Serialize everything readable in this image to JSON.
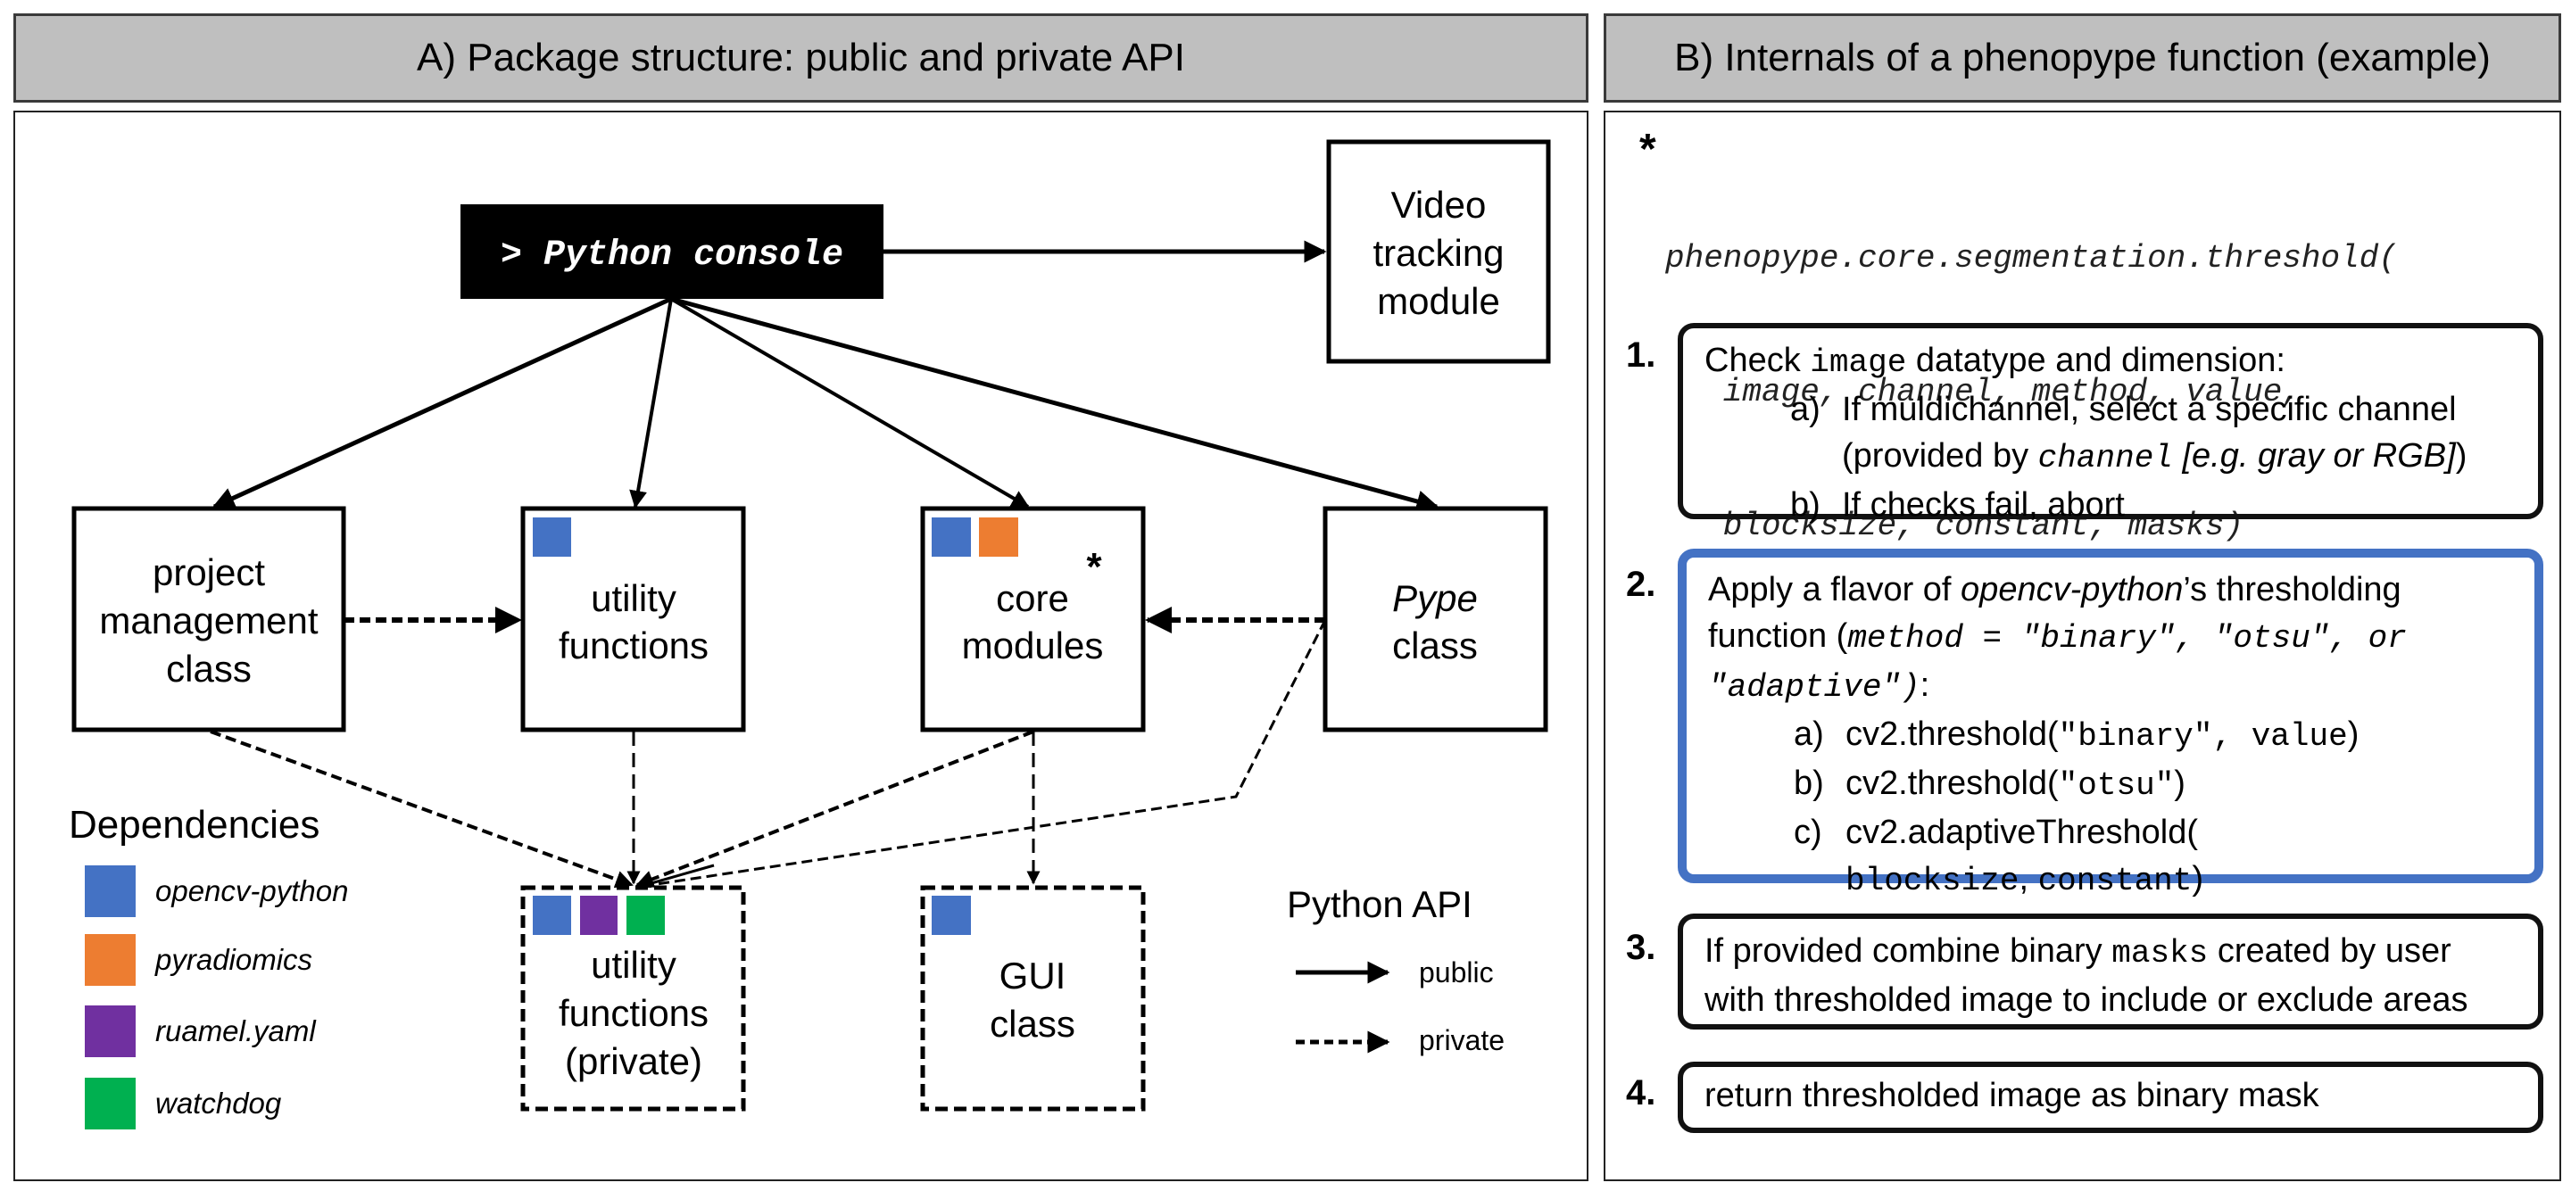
{
  "panel_a": {
    "header": "A) Package structure: public and private API",
    "console_label": "> Python console",
    "nodes": {
      "video": [
        "Video",
        "tracking",
        "module"
      ],
      "project": [
        "project",
        "management",
        "class"
      ],
      "utility": [
        "utility",
        "functions"
      ],
      "core": [
        "core",
        "modules"
      ],
      "core_marker": "*",
      "pype_italic": "Pype",
      "pype": "class",
      "utility_private": [
        "utility",
        "functions",
        "(private)"
      ],
      "gui": [
        "GUI",
        "class"
      ]
    },
    "dependencies": {
      "title": "Dependencies",
      "items": [
        {
          "name": "opencv-python",
          "color": "#4472c4"
        },
        {
          "name": "pyradiomics",
          "color": "#ed7d31"
        },
        {
          "name": "ruamel.yaml",
          "color": "#7030a0"
        },
        {
          "name": "watchdog",
          "color": "#00b050"
        }
      ]
    },
    "api_legend": {
      "title": "Python API",
      "public": "public",
      "private": "private"
    }
  },
  "panel_b": {
    "header": "B) Internals of a phenopype function (example)",
    "star": "*",
    "signature": [
      "phenopype.core.segmentation.threshold(",
      "   image, channel, method, value,",
      "   blocksize, constant, masks)"
    ],
    "steps": [
      {
        "num": "1.",
        "intro_pre": "Check ",
        "intro_code": "image",
        "intro_post": " datatype and dimension:",
        "a_lbl": "a)",
        "a_text": "If muldichannel, select a specific channel",
        "a_text2_pre": "(provided by ",
        "a_text2_code": "channel",
        "a_text2_it": " [e.g. gray or RGB]",
        "a_text2_post": ")",
        "b_lbl": "b)",
        "b_text": "If checks fail, abort"
      },
      {
        "num": "2.",
        "intro_pre": "Apply a flavor of ",
        "intro_it": "opencv-python",
        "intro_post": "’s thresholding",
        "line2_pre": "function (",
        "line2_code": "method = \"binary\", \"otsu\", or",
        "line3_code": "\"adaptive\")",
        "line3_post": ":",
        "a_lbl": "a)",
        "a_pre": "cv2.threshold(",
        "a_code": "\"binary\", value",
        "a_post": ")",
        "b_lbl": "b)",
        "b_pre": "cv2.threshold(",
        "b_code": "\"otsu\"",
        "b_post": ")",
        "c_lbl": "c)",
        "c_pre": "cv2.adaptiveThreshold(",
        "c_code1": "blocksize",
        "c_mid": ", ",
        "c_code2": "constant",
        "c_post": ")"
      },
      {
        "num": "3.",
        "pre": "If provided combine binary ",
        "code": "masks",
        "post": " created by user",
        "line2": "with thresholded image to include or exclude areas"
      },
      {
        "num": "4.",
        "text": "return thresholded image as binary mask"
      }
    ],
    "accent_color": "#4472c4"
  }
}
